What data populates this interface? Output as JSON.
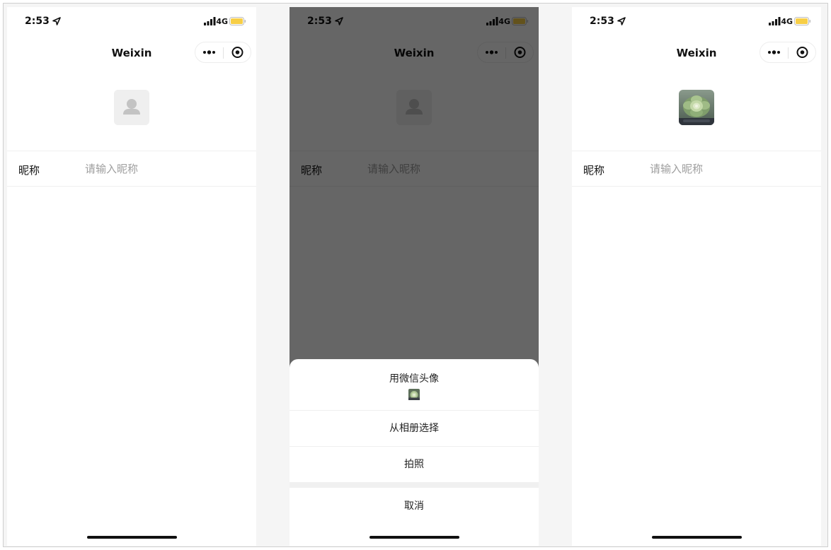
{
  "status": {
    "time": "2:53",
    "network": "4G"
  },
  "nav": {
    "title": "Weixin"
  },
  "form": {
    "nickname_label": "昵称",
    "nickname_placeholder": "请输入昵称"
  },
  "action_sheet": {
    "use_wechat_avatar": "用微信头像",
    "choose_from_album": "从相册选择",
    "take_photo": "拍照",
    "cancel": "取消"
  },
  "icons": {
    "location": "location-arrow-icon",
    "signal": "cellular-signal-icon",
    "battery": "battery-icon",
    "more": "more-dots-icon",
    "close": "close-circle-icon",
    "default_avatar": "default-avatar-icon",
    "chosen_avatar": "succulent-photo"
  },
  "colors": {
    "battery": "#f7ce46",
    "overlay": "#000000",
    "placeholder": "#9e9e9e"
  }
}
